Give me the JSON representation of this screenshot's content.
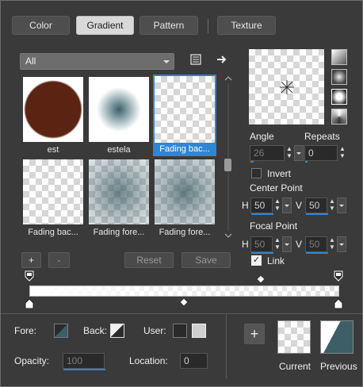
{
  "tabs": [
    {
      "label": "Color"
    },
    {
      "label": "Gradient"
    },
    {
      "label": "Pattern"
    },
    {
      "label": "Texture"
    }
  ],
  "category": {
    "selected": "All"
  },
  "gallery": {
    "items": [
      {
        "label": "est"
      },
      {
        "label": "estela"
      },
      {
        "label": "Fading bac..."
      },
      {
        "label": "Fading bac..."
      },
      {
        "label": "Fading fore..."
      },
      {
        "label": "Fading fore..."
      }
    ]
  },
  "buttons": {
    "add": "+",
    "remove": "-",
    "reset": "Reset",
    "save": "Save",
    "add_color": "+"
  },
  "angle": {
    "label": "Angle",
    "value": "26"
  },
  "repeats": {
    "label": "Repeats",
    "value": "0"
  },
  "invert": {
    "label": "Invert",
    "checked": false
  },
  "center_point": {
    "label": "Center Point",
    "h_label": "H",
    "h_value": "50",
    "v_label": "V",
    "v_value": "50"
  },
  "focal_point": {
    "label": "Focal Point",
    "h_label": "H",
    "h_value": "50",
    "v_label": "V",
    "v_value": "50"
  },
  "link": {
    "label": "Link",
    "checked": true
  },
  "colors": {
    "fore_label": "Fore:",
    "back_label": "Back:",
    "user_label": "User:",
    "accent": "#2f86d6",
    "gradient_teal": "#3d5e66"
  },
  "opacity": {
    "label": "Opacity:",
    "value": "100"
  },
  "location": {
    "label": "Location:",
    "value": "0"
  },
  "preview": {
    "current_label": "Current",
    "previous_label": "Previous"
  }
}
